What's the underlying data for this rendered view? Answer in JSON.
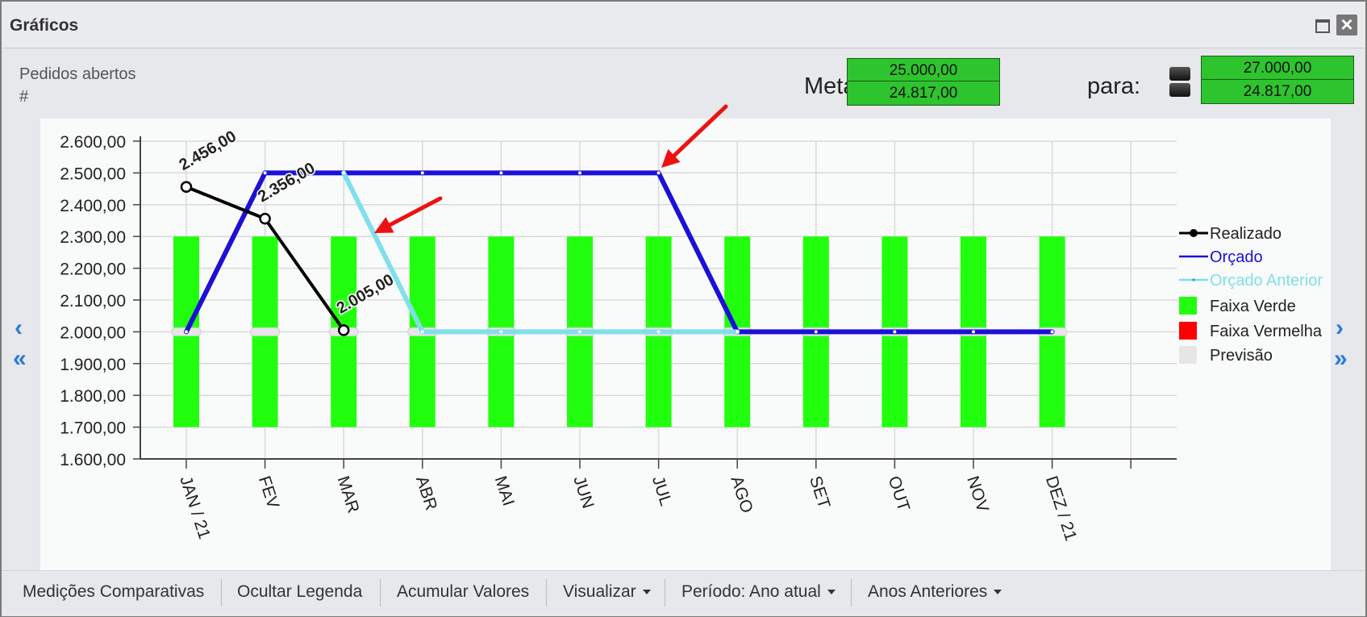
{
  "window": {
    "title": "Gráficos"
  },
  "header": {
    "subtitle": "Pedidos abertos",
    "unit": "#",
    "meta_label": "Meta de:",
    "meta_values": [
      "25.000,00",
      "24.817,00"
    ],
    "para_label": "para:",
    "para_values": [
      "27.000,00",
      "24.817,00"
    ]
  },
  "footer": {
    "buttons": [
      "Medições Comparativas",
      "Ocultar Legenda",
      "Acumular Valores",
      "Visualizar",
      "Período: Ano atual",
      "Anos Anteriores"
    ]
  },
  "colors": {
    "realizado": "#000000",
    "orcado": "#1c10d8",
    "orcado_anterior": "#7fe0ea",
    "faixa_verde": "#22ff0e",
    "faixa_vermelha": "#ff0000",
    "previsao": "#e6e6e6",
    "annotation_arrow": "#ee1111"
  },
  "chart_data": {
    "type": "line",
    "categories": [
      "JAN / 21",
      "FEV",
      "MAR",
      "ABR",
      "MAI",
      "JUN",
      "JUL",
      "AGO",
      "SET",
      "OUT",
      "NOV",
      "DEZ / 21"
    ],
    "ylim": [
      1600,
      2600
    ],
    "y_ticks": [
      "1.600,00",
      "1.700,00",
      "1.800,00",
      "1.900,00",
      "2.000,00",
      "2.100,00",
      "2.200,00",
      "2.300,00",
      "2.400,00",
      "2.500,00",
      "2.600,00"
    ],
    "y_tick_values": [
      1600,
      1700,
      1800,
      1900,
      2000,
      2100,
      2200,
      2300,
      2400,
      2500,
      2600
    ],
    "grid": true,
    "legend_position": "right",
    "faixa_verde": {
      "low": 1700,
      "high": 2300
    },
    "previsao_value": 2000,
    "series": [
      {
        "name": "Realizado",
        "values": [
          2456,
          2356,
          2005,
          null,
          null,
          null,
          null,
          null,
          null,
          null,
          null,
          null
        ],
        "labels": [
          "2.456,00",
          "2.356,00",
          "2.005,00"
        ]
      },
      {
        "name": "Orçado",
        "values": [
          2000,
          2500,
          2500,
          2500,
          2500,
          2500,
          2500,
          2000,
          2000,
          2000,
          2000,
          2000
        ]
      },
      {
        "name": "Orçado Anterior",
        "values": [
          null,
          null,
          2500,
          2000,
          2000,
          2000,
          2000,
          2000,
          null,
          null,
          null,
          null
        ]
      }
    ],
    "legend": [
      "Realizado",
      "Orçado",
      "Orçado Anterior",
      "Faixa Verde",
      "Faixa Vermelha",
      "Previsão"
    ]
  }
}
